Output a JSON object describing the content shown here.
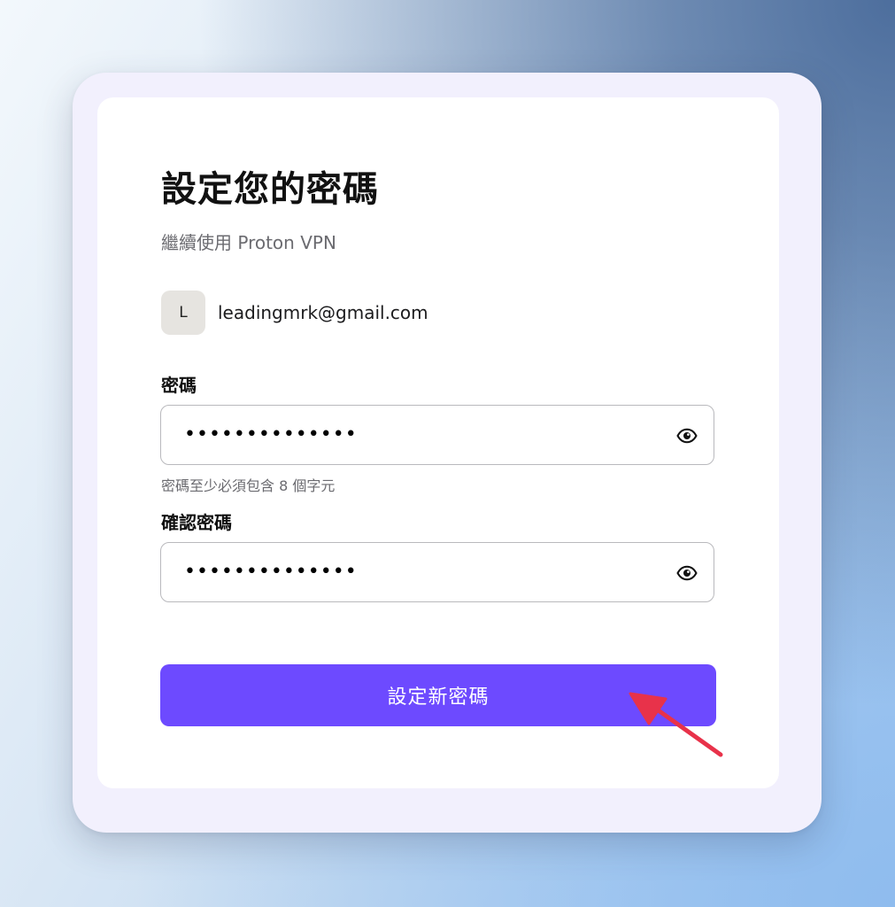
{
  "header": {
    "title": "設定您的密碼",
    "subtitle": "繼續使用 Proton VPN"
  },
  "account": {
    "avatar_initial": "L",
    "email": "leadingmrk@gmail.com"
  },
  "password_field": {
    "label": "密碼",
    "masked_value": "••••••••••••••",
    "hint": "密碼至少必須包含 8 個字元",
    "toggle_icon": "eye-icon"
  },
  "confirm_field": {
    "label": "確認密碼",
    "masked_value": "••••••••••••••",
    "toggle_icon": "eye-icon"
  },
  "submit": {
    "label": "設定新密碼"
  },
  "colors": {
    "brand": "#6d4aff",
    "annotation_arrow": "#e8324a"
  }
}
